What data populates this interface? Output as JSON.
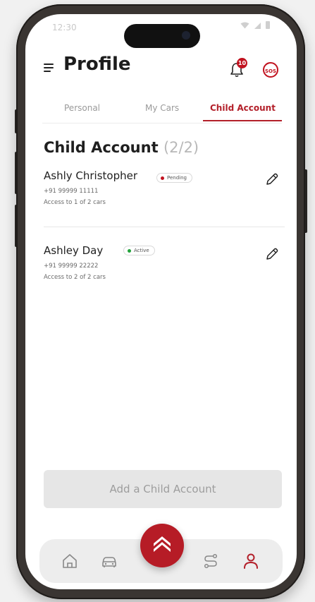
{
  "status_bar": {
    "time": "12:30"
  },
  "header": {
    "title": "Profile",
    "notification_count": "10",
    "sos_label": "SOS"
  },
  "tabs": [
    {
      "label": "Personal",
      "active": false
    },
    {
      "label": "My Cars",
      "active": false
    },
    {
      "label": "Child Account",
      "active": true
    }
  ],
  "section": {
    "title": "Child Account",
    "count": "(2/2)"
  },
  "children": [
    {
      "name": "Ashly Christopher",
      "status": "Pending",
      "status_color": "#c1121f",
      "phone": "+91 99999 11111",
      "access": "Access to 1 of 2 cars"
    },
    {
      "name": "Ashley Day",
      "status": "Active",
      "status_color": "#22a23a",
      "phone": "+91 99999 22222",
      "access": "Access to 2 of 2 cars"
    }
  ],
  "add_button": {
    "label": "Add a Child Account"
  },
  "bottom_nav": [
    {
      "icon": "home-icon"
    },
    {
      "icon": "car-icon"
    },
    {
      "icon": "brand-logo-icon"
    },
    {
      "icon": "route-icon"
    },
    {
      "icon": "profile-icon",
      "active": true
    }
  ],
  "colors": {
    "accent": "#b3202a",
    "brand_red": "#c1121f",
    "active_green": "#22a23a"
  }
}
